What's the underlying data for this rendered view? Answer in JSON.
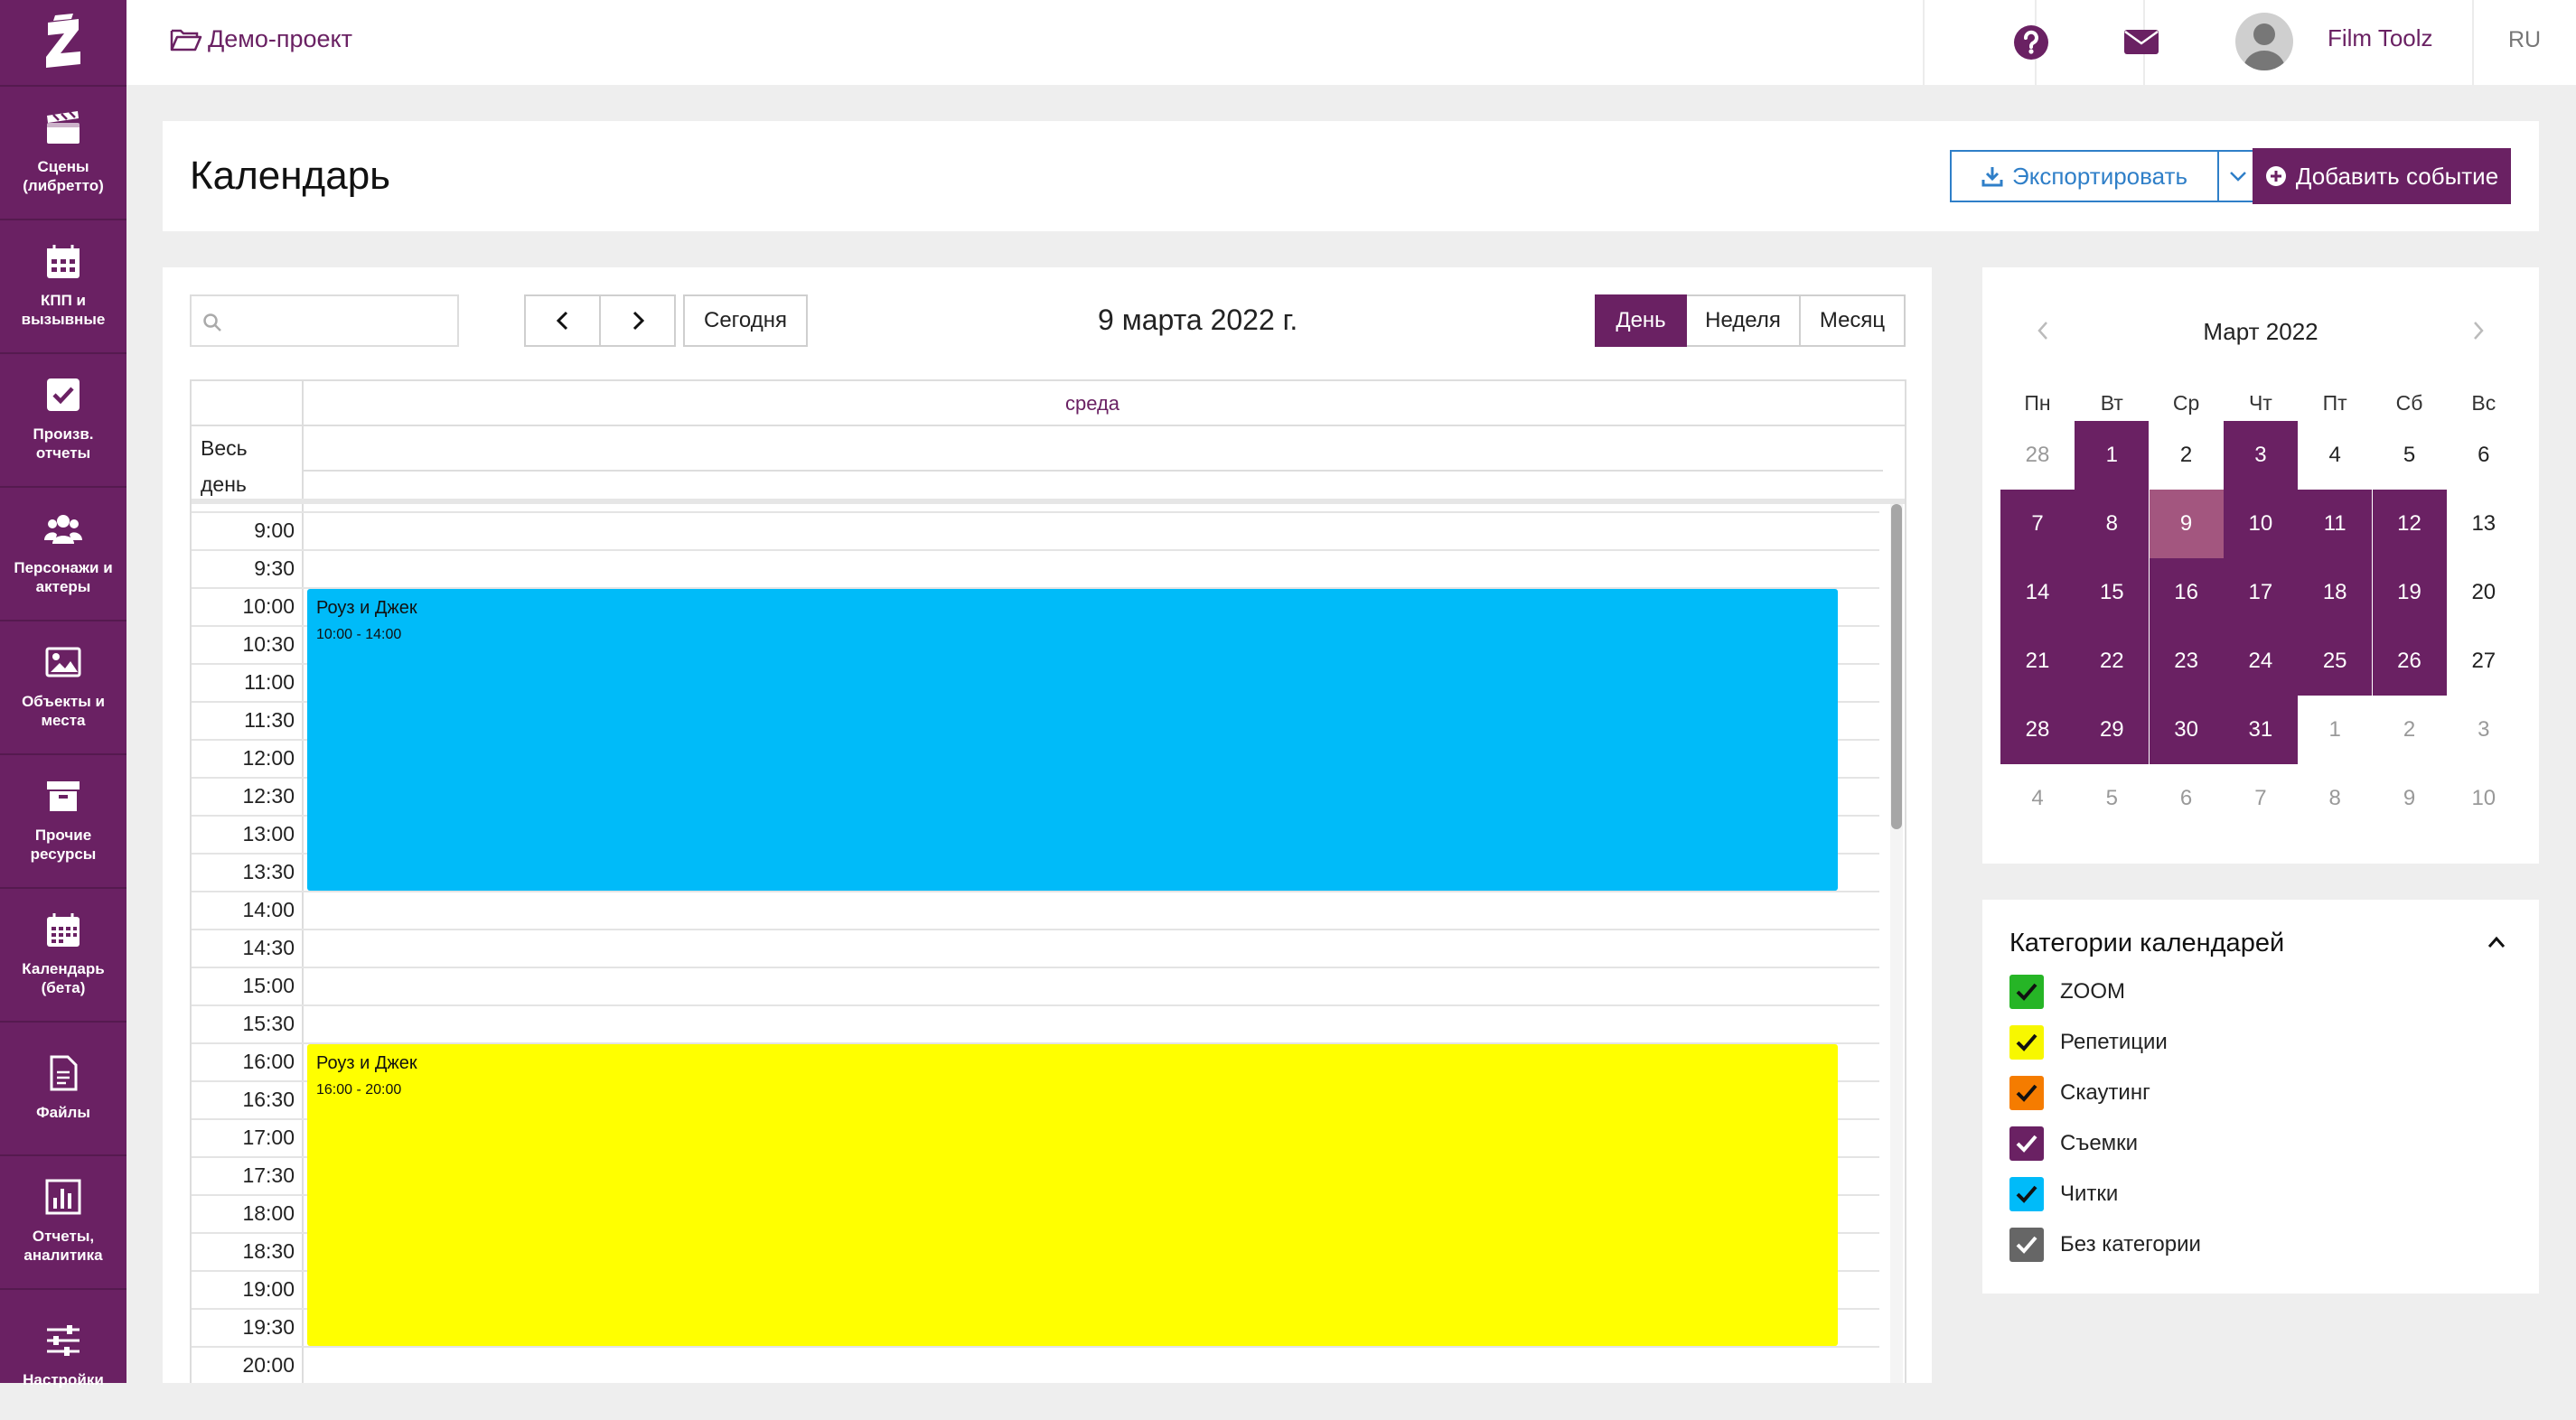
{
  "topbar": {
    "project": "Демо-проект",
    "user": "Film Toolz",
    "lang": "RU"
  },
  "sidebar": {
    "items": [
      {
        "label": "Сцены\n(либретто)",
        "icon": "clapperboard-icon"
      },
      {
        "label": "КПП и\nвызывные",
        "icon": "calendar-grid-icon"
      },
      {
        "label": "Произв. отчеты",
        "icon": "checkbox-icon"
      },
      {
        "label": "Персонажи и\nактеры",
        "icon": "users-icon"
      },
      {
        "label": "Объекты и\nместа",
        "icon": "image-icon"
      },
      {
        "label": "Прочие\nресурсы",
        "icon": "archive-box-icon"
      },
      {
        "label": "Календарь\n(бета)",
        "icon": "calendar-icon"
      },
      {
        "label": "Файлы",
        "icon": "file-icon"
      },
      {
        "label": "Отчеты,\nаналитика",
        "icon": "bar-chart-icon"
      },
      {
        "label": "Настройки",
        "icon": "sliders-icon"
      }
    ]
  },
  "header": {
    "title": "Календарь",
    "export_label": "Экспортировать",
    "add_label": "Добавить событие"
  },
  "toolbar": {
    "today": "Сегодня",
    "current_date": "9 марта 2022 г.",
    "views": [
      "День",
      "Неделя",
      "Месяц"
    ],
    "active_view": "День"
  },
  "day_view": {
    "day_name": "среда",
    "allday_label": "Весь день",
    "slots": [
      "9:00",
      "9:30",
      "10:00",
      "10:30",
      "11:00",
      "11:30",
      "12:00",
      "12:30",
      "13:00",
      "13:30",
      "14:00",
      "14:30",
      "15:00",
      "15:30",
      "16:00",
      "16:30",
      "17:00",
      "17:30",
      "18:00",
      "18:30",
      "19:00",
      "19:30",
      "20:00"
    ],
    "events": [
      {
        "title": "Роуз и Джек",
        "time": "10:00 - 14:00",
        "start": "10:00",
        "end": "14:00",
        "color": "#00bbf9"
      },
      {
        "title": "Роуз и Джек",
        "time": "16:00 - 20:00",
        "start": "16:00",
        "end": "20:00",
        "color": "#ffff00"
      }
    ]
  },
  "mini_calendar": {
    "title": "Март 2022",
    "weekdays": [
      "Пн",
      "Вт",
      "Ср",
      "Чт",
      "Пт",
      "Сб",
      "Вс"
    ],
    "weeks": [
      [
        {
          "d": "28",
          "s": "out"
        },
        {
          "d": "1",
          "s": "ev"
        },
        {
          "d": "2",
          "s": ""
        },
        {
          "d": "3",
          "s": "ev"
        },
        {
          "d": "4",
          "s": ""
        },
        {
          "d": "5",
          "s": ""
        },
        {
          "d": "6",
          "s": ""
        }
      ],
      [
        {
          "d": "7",
          "s": "ev"
        },
        {
          "d": "8",
          "s": "ev"
        },
        {
          "d": "9",
          "s": "today"
        },
        {
          "d": "10",
          "s": "ev"
        },
        {
          "d": "11",
          "s": "ev"
        },
        {
          "d": "12",
          "s": "ev"
        },
        {
          "d": "13",
          "s": ""
        }
      ],
      [
        {
          "d": "14",
          "s": "ev"
        },
        {
          "d": "15",
          "s": "ev"
        },
        {
          "d": "16",
          "s": "ev"
        },
        {
          "d": "17",
          "s": "ev"
        },
        {
          "d": "18",
          "s": "ev"
        },
        {
          "d": "19",
          "s": "ev"
        },
        {
          "d": "20",
          "s": ""
        }
      ],
      [
        {
          "d": "21",
          "s": "ev"
        },
        {
          "d": "22",
          "s": "ev"
        },
        {
          "d": "23",
          "s": "ev"
        },
        {
          "d": "24",
          "s": "ev"
        },
        {
          "d": "25",
          "s": "ev"
        },
        {
          "d": "26",
          "s": "ev"
        },
        {
          "d": "27",
          "s": ""
        }
      ],
      [
        {
          "d": "28",
          "s": "ev"
        },
        {
          "d": "29",
          "s": "ev"
        },
        {
          "d": "30",
          "s": "ev"
        },
        {
          "d": "31",
          "s": "ev"
        },
        {
          "d": "1",
          "s": "out"
        },
        {
          "d": "2",
          "s": "out"
        },
        {
          "d": "3",
          "s": "out"
        }
      ],
      [
        {
          "d": "4",
          "s": "out"
        },
        {
          "d": "5",
          "s": "out"
        },
        {
          "d": "6",
          "s": "out"
        },
        {
          "d": "7",
          "s": "out"
        },
        {
          "d": "8",
          "s": "out"
        },
        {
          "d": "9",
          "s": "out"
        },
        {
          "d": "10",
          "s": "out"
        }
      ]
    ]
  },
  "categories": {
    "title": "Категории календарей",
    "items": [
      {
        "label": "ZOOM",
        "color": "#26b526"
      },
      {
        "label": "Репетиции",
        "color": "#f7f700"
      },
      {
        "label": "Скаутинг",
        "color": "#f57c00"
      },
      {
        "label": "Съемки",
        "color": "#6a2163"
      },
      {
        "label": "Читки",
        "color": "#00bbf9"
      },
      {
        "label": "Без категории",
        "color": "#666666"
      }
    ]
  },
  "colors": {
    "brand": "#6a2163",
    "export": "#2f7fc8"
  }
}
